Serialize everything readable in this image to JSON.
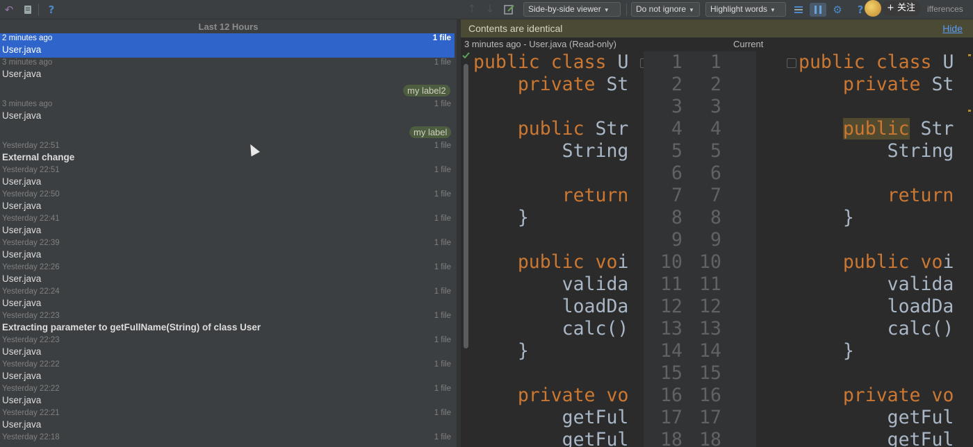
{
  "toolbar": {
    "icons": [
      "revert-icon",
      "patch-icon",
      "help-icon",
      "up-arrow-icon",
      "down-arrow-icon",
      "edit-source-icon",
      "collapse-unchanged-icon",
      "sync-scroll-icon",
      "gear-icon",
      "help-icon"
    ],
    "help_glyph": "?",
    "viewer_select": "Side-by-side viewer",
    "ignore_select": "Do not ignore",
    "highlight_select": "Highlight words",
    "follow_button": "+ 关注",
    "differences_label": "ifferences"
  },
  "history": {
    "group_header": "Last 12 Hours",
    "rows": [
      {
        "time": "2 minutes ago",
        "name": "User.java",
        "files": "1 file",
        "bold": false,
        "selected": true
      },
      {
        "time": "3 minutes ago",
        "name": "User.java",
        "files": "1 file",
        "bold": false,
        "selected": false
      },
      {
        "time": "3 minutes ago",
        "name": "User.java",
        "files": "1 file",
        "bold": false,
        "selected": false
      },
      {
        "time": "Yesterday 22:51",
        "name": "External change",
        "files": "1 file",
        "bold": true,
        "selected": false
      },
      {
        "time": "Yesterday 22:51",
        "name": "User.java",
        "files": "1 file",
        "bold": false,
        "selected": false
      },
      {
        "time": "Yesterday 22:50",
        "name": "User.java",
        "files": "1 file",
        "bold": false,
        "selected": false
      },
      {
        "time": "Yesterday 22:41",
        "name": "User.java",
        "files": "1 file",
        "bold": false,
        "selected": false
      },
      {
        "time": "Yesterday 22:39",
        "name": "User.java",
        "files": "1 file",
        "bold": false,
        "selected": false
      },
      {
        "time": "Yesterday 22:26",
        "name": "User.java",
        "files": "1 file",
        "bold": false,
        "selected": false
      },
      {
        "time": "Yesterday 22:24",
        "name": "User.java",
        "files": "1 file",
        "bold": false,
        "selected": false
      },
      {
        "time": "Yesterday 22:23",
        "name": "Extracting parameter to getFullName(String) of class User",
        "files": "1 file",
        "bold": true,
        "selected": false
      },
      {
        "time": "Yesterday 22:23",
        "name": "User.java",
        "files": "1 file",
        "bold": false,
        "selected": false
      },
      {
        "time": "Yesterday 22:22",
        "name": "User.java",
        "files": "1 file",
        "bold": false,
        "selected": false
      },
      {
        "time": "Yesterday 22:22",
        "name": "User.java",
        "files": "1 file",
        "bold": false,
        "selected": false
      },
      {
        "time": "Yesterday 22:21",
        "name": "User.java",
        "files": "1 file",
        "bold": false,
        "selected": false
      },
      {
        "time": "Yesterday 22:18",
        "name": "",
        "files": "1 file",
        "bold": false,
        "selected": false
      }
    ],
    "labels": [
      "my label2",
      "my label"
    ]
  },
  "diff": {
    "notice": "Contents are identical",
    "hide_link": "Hide",
    "left_title": "3 minutes ago - User.java (Read-only)",
    "right_title": "Current",
    "line_numbers": [
      "1",
      "2",
      "3",
      "4",
      "5",
      "6",
      "7",
      "8",
      "9",
      "10",
      "11",
      "12",
      "13",
      "14",
      "15",
      "16",
      "17",
      "18"
    ],
    "left_lines": [
      "public class U",
      "    private St",
      "",
      "    public Str",
      "        String",
      "",
      "        return",
      "    }",
      "",
      "    public voi",
      "        valida",
      "        loadDa",
      "        calc()",
      "    }",
      "",
      "    private vo",
      "        getFul",
      "        getFul"
    ],
    "right_lines": [
      "public class U",
      "    private St",
      "",
      "    public Str",
      "        String",
      "",
      "        return",
      "    }",
      "",
      "    public voi",
      "        valida",
      "        loadDa",
      "        calc()",
      "    }",
      "",
      "    private vo",
      "        getFul",
      "        getFul"
    ]
  }
}
